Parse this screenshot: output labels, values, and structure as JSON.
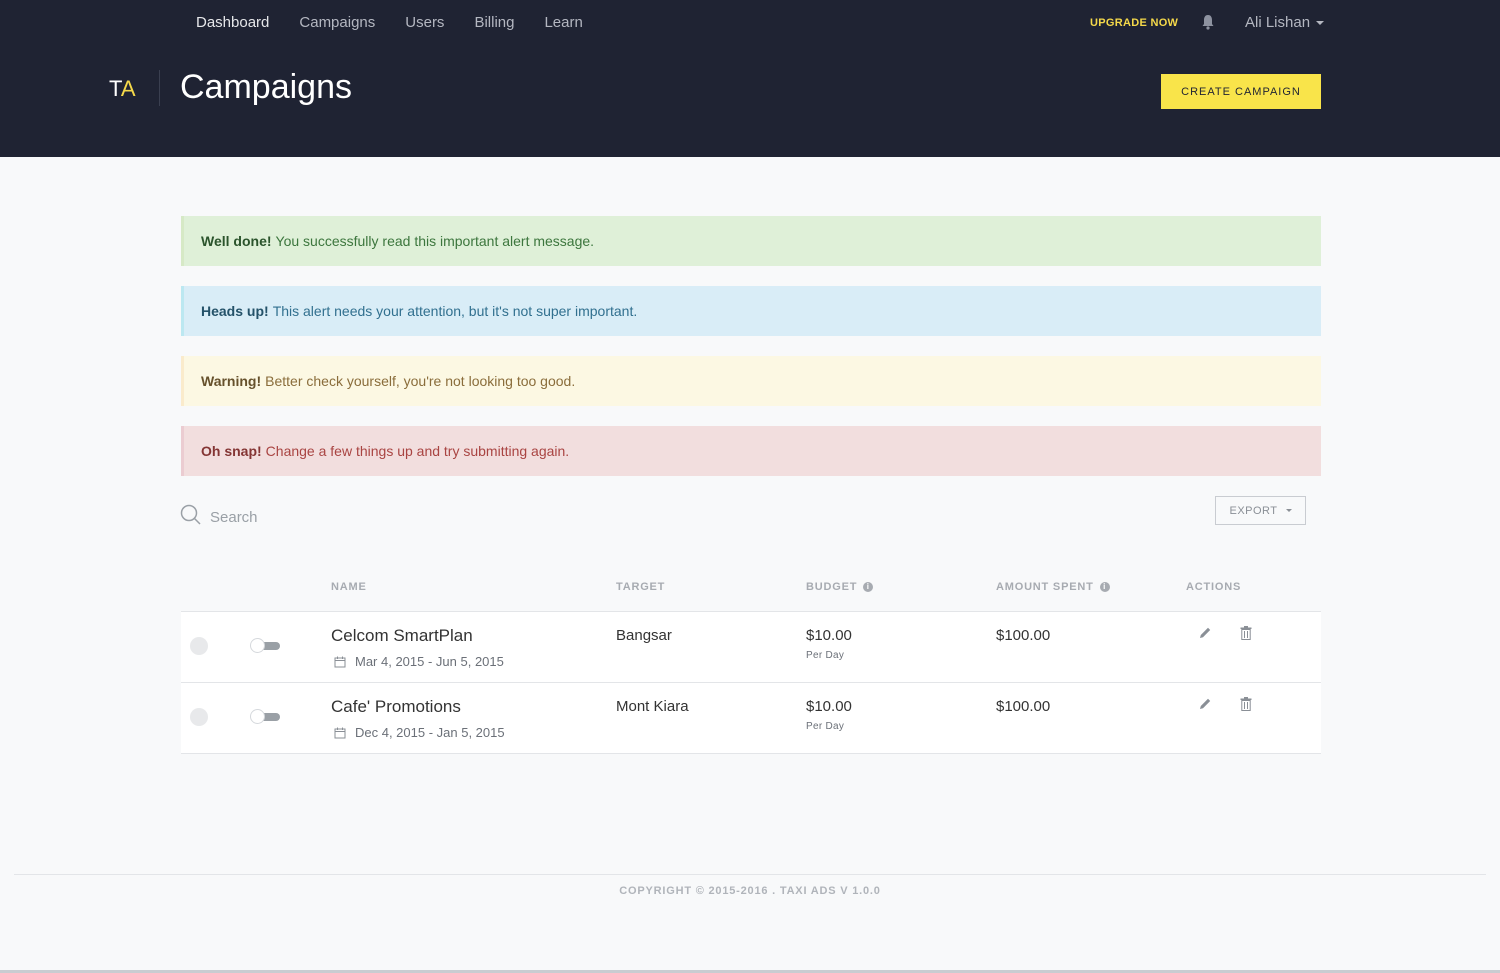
{
  "nav": {
    "items": [
      {
        "label": "Dashboard"
      },
      {
        "label": "Campaigns"
      },
      {
        "label": "Users"
      },
      {
        "label": "Billing"
      },
      {
        "label": "Learn"
      }
    ],
    "upgrade_label": "UPGRADE NOW",
    "user_name": "Ali Lishan"
  },
  "logo": {
    "t": "T",
    "a": "A"
  },
  "header": {
    "title": "Campaigns",
    "create_label": "CREATE CAMPAIGN"
  },
  "alerts": [
    {
      "strong": "Well done!",
      "text": "You successfully read this important alert message."
    },
    {
      "strong": "Heads up!",
      "text": "This alert needs your attention, but it's not super important."
    },
    {
      "strong": "Warning!",
      "text": "Better check yourself, you're not looking too good."
    },
    {
      "strong": "Oh snap!",
      "text": "Change a few things up and try submitting again."
    }
  ],
  "search": {
    "placeholder": "Search",
    "value": ""
  },
  "export_label": "EXPORT",
  "table": {
    "headers": {
      "name": "NAME",
      "target": "TARGET",
      "budget": "BUDGET",
      "spent": "AMOUNT SPENT",
      "actions": "ACTIONS"
    },
    "rows": [
      {
        "name": "Celcom SmartPlan",
        "dates": "Mar 4, 2015 - Jun 5, 2015",
        "target": "Bangsar",
        "budget": "$10.00",
        "per": "Per Day",
        "spent": "$100.00"
      },
      {
        "name": "Cafe' Promotions",
        "dates": "Dec 4, 2015 - Jan 5, 2015",
        "target": "Mont Kiara",
        "budget": "$10.00",
        "per": "Per Day",
        "spent": "$100.00"
      }
    ]
  },
  "footer": {
    "copyright": "COPYRIGHT © 2015-2016 . TAXI ADS V 1.0.0"
  },
  "colors": {
    "header_bg": "#1f2333",
    "accent": "#f9e44a"
  },
  "icons": [
    "bell-icon",
    "search-icon",
    "calendar-icon",
    "pencil-icon",
    "trash-icon",
    "info-icon",
    "chevron-down-icon"
  ]
}
